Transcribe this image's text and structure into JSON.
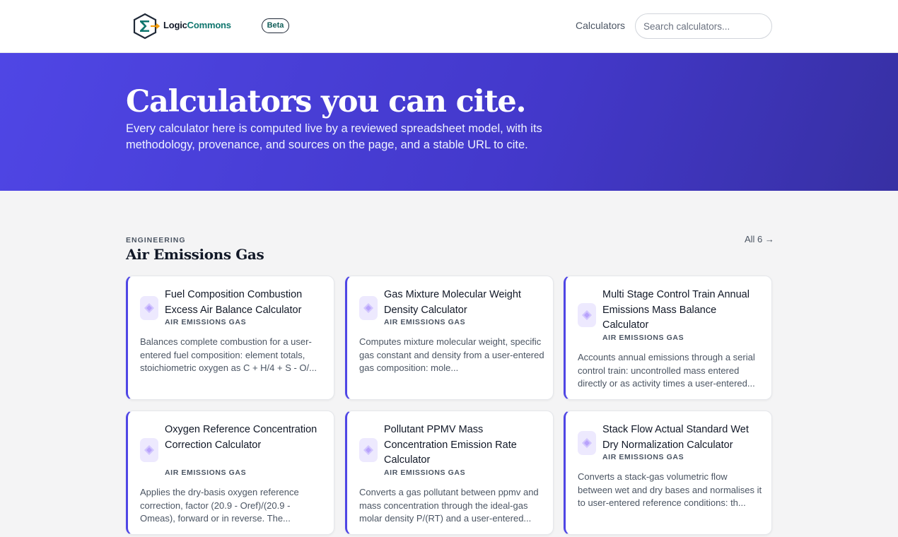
{
  "header": {
    "brand_part1": "Logic",
    "brand_part2": "Commons",
    "beta_label": "Beta",
    "nav_calculators": "Calculators",
    "search_placeholder": "Search calculators..."
  },
  "hero": {
    "title": "Calculators you can cite.",
    "subtitle": "Every calculator here is computed live by a reviewed spreadsheet model, with its methodology, provenance, and sources on the page, and a stable URL to cite."
  },
  "section": {
    "eyebrow": "ENGINEERING",
    "title": "Air Emissions Gas",
    "all_link": "All 6 →"
  },
  "cards": [
    {
      "title": "Fuel Composition Combustion Excess Air Balance Calculator",
      "tag": "AIR EMISSIONS GAS",
      "description": "Balances complete combustion for a user-entered fuel composition: element totals, stoichiometric oxygen as C + H/4 + S - O/..."
    },
    {
      "title": "Gas Mixture Molecular Weight Density Calculator",
      "tag": "AIR EMISSIONS GAS",
      "description": "Computes mixture molecular weight, specific gas constant and density from a user-entered gas composition: mole..."
    },
    {
      "title": "Multi Stage Control Train Annual Emissions Mass Balance Calculator",
      "tag": "AIR EMISSIONS GAS",
      "description": "Accounts annual emissions through a serial control train: uncontrolled mass entered directly or as activity times a user-entered..."
    },
    {
      "title": "Oxygen Reference Concentration Correction Calculator",
      "tag": "AIR EMISSIONS GAS",
      "description": "Applies the dry-basis oxygen reference correction, factor (20.9 - Oref)/(20.9 - Omeas), forward or in reverse. The..."
    },
    {
      "title": "Pollutant PPMV Mass Concentration Emission Rate Calculator",
      "tag": "AIR EMISSIONS GAS",
      "description": "Converts a gas pollutant between ppmv and mass concentration through the ideal-gas molar density P/(RT) and a user-entered..."
    },
    {
      "title": "Stack Flow Actual Standard Wet Dry Normalization Calculator",
      "tag": "AIR EMISSIONS GAS",
      "description": "Converts a stack-gas volumetric flow between wet and dry bases and normalises it to user-entered reference conditions: th..."
    }
  ],
  "colors": {
    "accent": "#4f46e5",
    "hero_start": "#4f46e5",
    "hero_end": "#3730a3",
    "brand_teal": "#0f766e"
  }
}
